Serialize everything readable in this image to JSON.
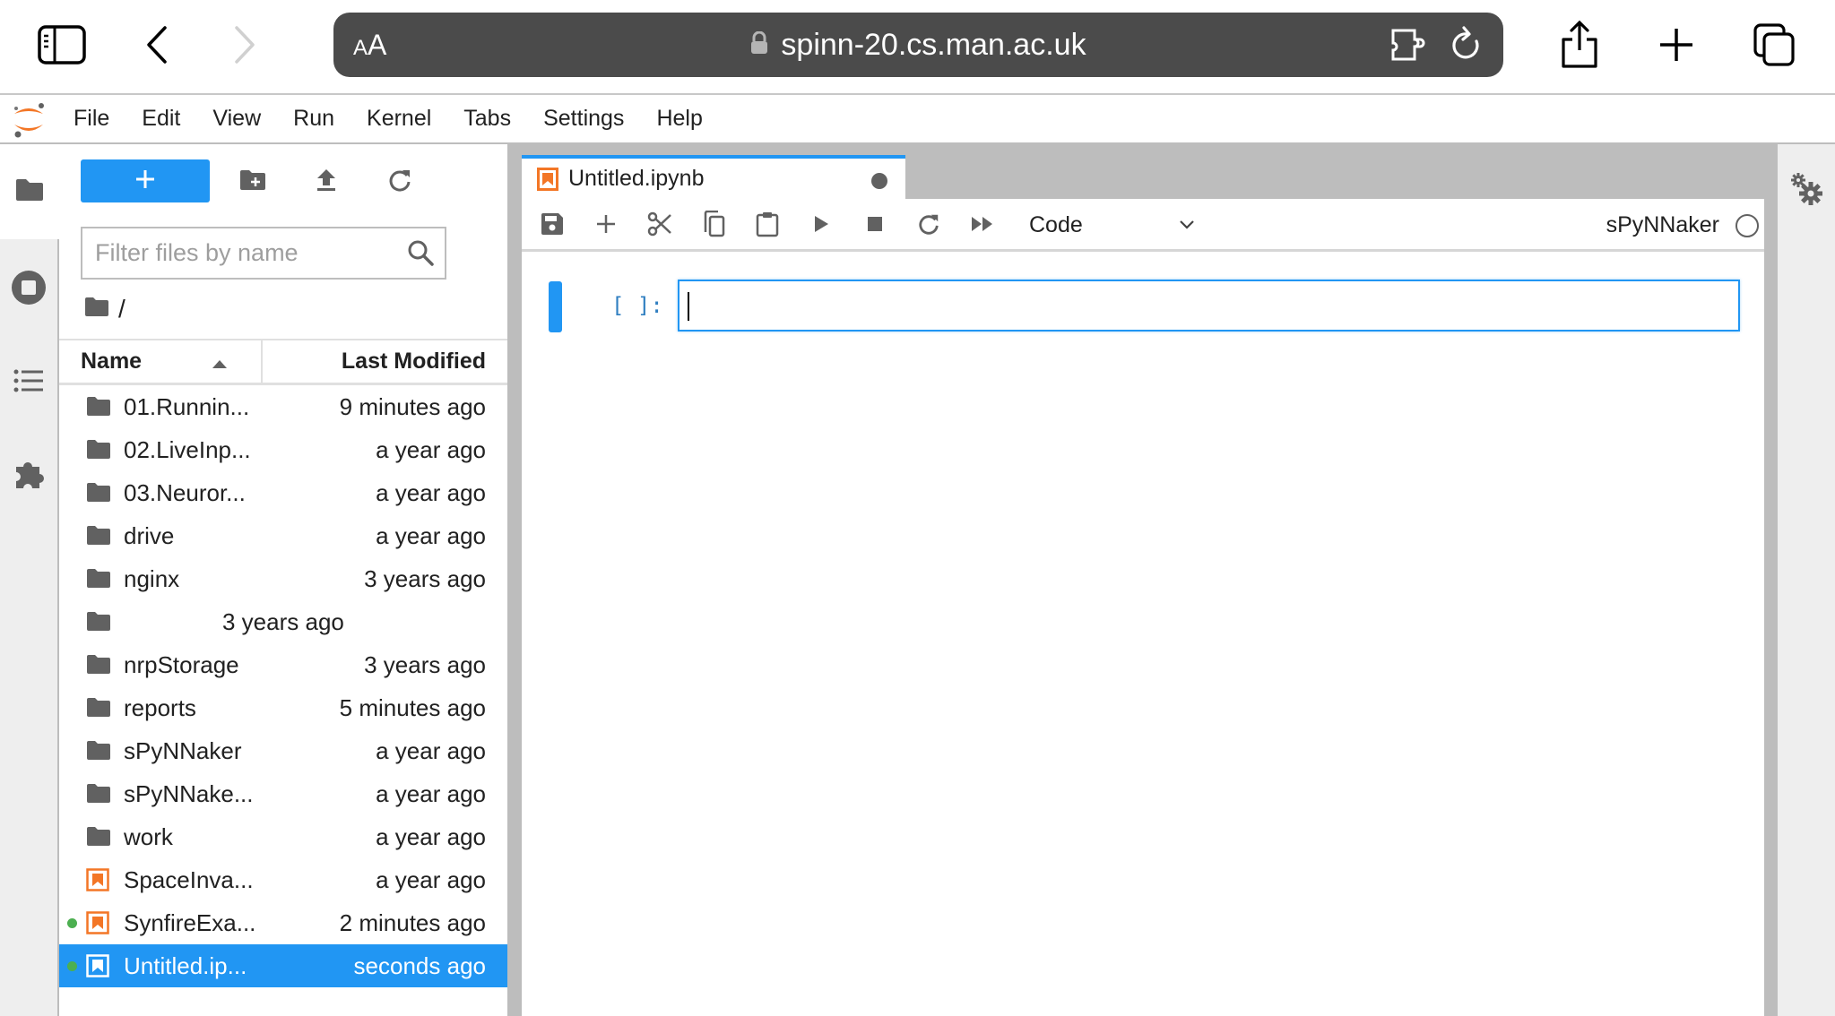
{
  "browser": {
    "text_size_button": {
      "small": "A",
      "large": "A"
    },
    "url": "spinn-20.cs.man.ac.uk",
    "icons": [
      "sidebar-toggle-icon",
      "back-icon",
      "forward-icon",
      "lock-icon",
      "extension-icon",
      "reload-icon",
      "share-icon",
      "new-tab-icon",
      "tabs-overview-icon"
    ]
  },
  "menubar": {
    "items": [
      "File",
      "Edit",
      "View",
      "Run",
      "Kernel",
      "Tabs",
      "Settings",
      "Help"
    ]
  },
  "activity_bar": {
    "items": [
      {
        "name": "file-browser",
        "icon": "folder-icon",
        "active": true
      },
      {
        "name": "running-terminals-kernels",
        "icon": "stop-circle-icon",
        "active": false
      },
      {
        "name": "table-of-contents",
        "icon": "list-icon",
        "active": false
      },
      {
        "name": "extension-manager",
        "icon": "puzzle-icon",
        "active": false
      }
    ]
  },
  "file_browser": {
    "new_launcher_label": "+",
    "filter_placeholder": "Filter files by name",
    "filter_value": "",
    "breadcrumb": "/",
    "columns": {
      "name": "Name",
      "last_modified": "Last Modified"
    },
    "sort": {
      "column": "name",
      "direction": "ascending"
    },
    "files": [
      {
        "name": "01.Runnin...",
        "modified": "9 minutes ago",
        "type": "folder",
        "running": false,
        "selected": false
      },
      {
        "name": "02.LiveInp...",
        "modified": "a year ago",
        "type": "folder",
        "running": false,
        "selected": false
      },
      {
        "name": "03.Neuror...",
        "modified": "a year ago",
        "type": "folder",
        "running": false,
        "selected": false
      },
      {
        "name": "drive",
        "modified": "a year ago",
        "type": "folder",
        "running": false,
        "selected": false
      },
      {
        "name": "nginx",
        "modified": "3 years ago",
        "type": "folder",
        "running": false,
        "selected": false
      },
      {
        "name": "",
        "modified": "3 years ago",
        "type": "folder",
        "running": false,
        "selected": false
      },
      {
        "name": "nrpStorage",
        "modified": "3 years ago",
        "type": "folder",
        "running": false,
        "selected": false
      },
      {
        "name": "reports",
        "modified": "5 minutes ago",
        "type": "folder",
        "running": false,
        "selected": false
      },
      {
        "name": "sPyNNaker",
        "modified": "a year ago",
        "type": "folder",
        "running": false,
        "selected": false
      },
      {
        "name": "sPyNNake...",
        "modified": "a year ago",
        "type": "folder",
        "running": false,
        "selected": false
      },
      {
        "name": "work",
        "modified": "a year ago",
        "type": "folder",
        "running": false,
        "selected": false
      },
      {
        "name": "SpaceInva...",
        "modified": "a year ago",
        "type": "notebook",
        "running": false,
        "selected": false
      },
      {
        "name": "SynfireExa...",
        "modified": "2 minutes ago",
        "type": "notebook",
        "running": true,
        "selected": false
      },
      {
        "name": "Untitled.ip...",
        "modified": "seconds ago",
        "type": "notebook",
        "running": true,
        "selected": true
      }
    ]
  },
  "notebook": {
    "tab": {
      "title": "Untitled.ipynb",
      "dirty": true
    },
    "toolbar": {
      "buttons": [
        "save",
        "insert-cell",
        "cut",
        "copy",
        "paste",
        "run",
        "interrupt",
        "restart",
        "restart-run-all"
      ],
      "cell_type": "Code",
      "kernel_name": "sPyNNaker",
      "kernel_status": "idle"
    },
    "cells": [
      {
        "type": "code",
        "prompt": "[ ]:",
        "source": "",
        "active": true
      }
    ]
  },
  "colors": {
    "accent": "#2196f3",
    "notebook_orange": "#f37626",
    "running_green": "#4caf50",
    "url_bar": "#4b4b4b",
    "icon_gray": "#616161",
    "dock_gray": "#bdbdbd"
  }
}
